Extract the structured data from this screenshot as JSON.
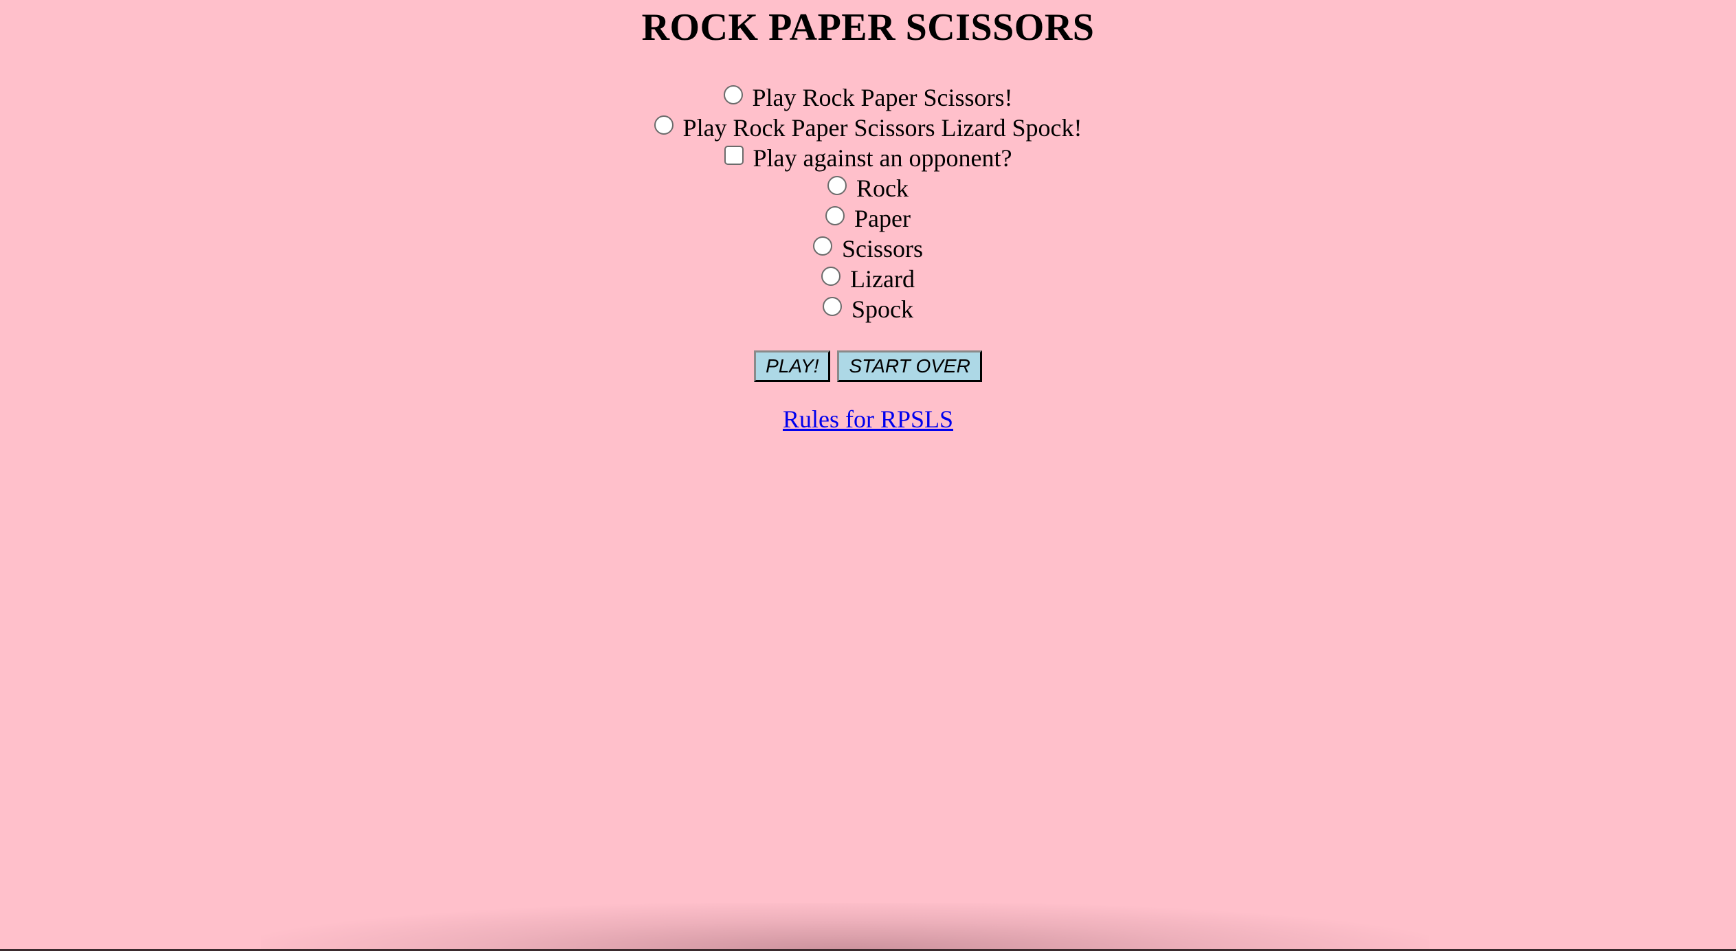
{
  "page": {
    "title": "ROCK PAPER SCISSORS",
    "background_color": "#ffc0cb"
  },
  "modes": [
    {
      "label": "Play Rock Paper Scissors!",
      "type": "radio",
      "checked": false
    },
    {
      "label": "Play Rock Paper Scissors Lizard Spock!",
      "type": "radio",
      "checked": false
    }
  ],
  "opponent": {
    "label": "Play against an opponent?",
    "type": "checkbox",
    "checked": false
  },
  "choices": [
    {
      "label": "Rock",
      "type": "radio",
      "checked": false
    },
    {
      "label": "Paper",
      "type": "radio",
      "checked": false
    },
    {
      "label": "Scissors",
      "type": "radio",
      "checked": false
    },
    {
      "label": "Lizard",
      "type": "radio",
      "checked": false
    },
    {
      "label": "Spock",
      "type": "radio",
      "checked": false
    }
  ],
  "buttons": {
    "play_label": "PLAY!",
    "start_over_label": "START OVER",
    "color": "#add8e6"
  },
  "rules_link": {
    "text": "Rules for RPSLS",
    "color": "#0000ee"
  }
}
